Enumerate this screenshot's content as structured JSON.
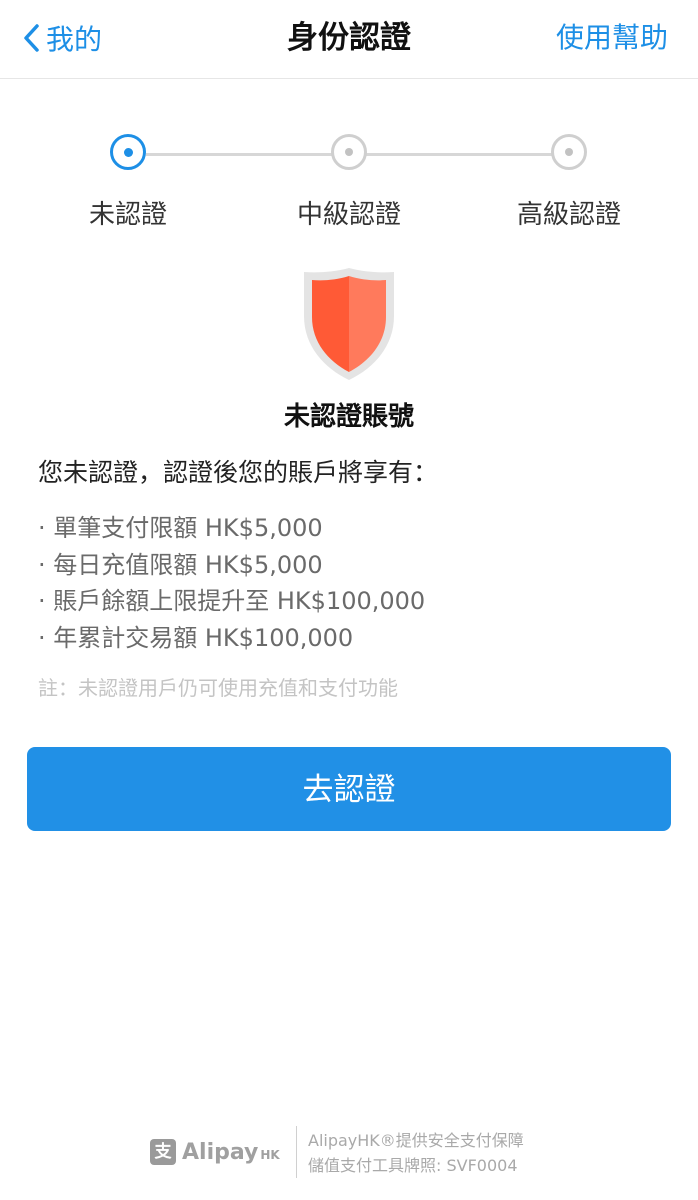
{
  "nav": {
    "back_label": "我的",
    "title": "身份認證",
    "help_label": "使用幫助"
  },
  "stepper": {
    "steps": [
      {
        "label": "未認證",
        "active": true
      },
      {
        "label": "中級認證",
        "active": false
      },
      {
        "label": "高級認證",
        "active": false
      }
    ]
  },
  "account": {
    "status_title": "未認證賬號",
    "intro": "您未認證，認證後您的賬戶將享有：",
    "benefits": [
      "· 單筆支付限額 HK$5,000",
      "· 每日充值限額 HK$5,000",
      "· 賬戶餘額上限提升至 HK$100,000",
      "· 年累計交易額 HK$100,000"
    ],
    "note": "註：未認證用戶仍可使用充值和支付功能"
  },
  "cta": {
    "label": "去認證"
  },
  "footer": {
    "logo_mark": "支",
    "logo_text": "Alipay",
    "logo_sub": "HK",
    "line1": "AlipayHK®提供安全支付保障",
    "line2": "儲值支付工具牌照: SVF0004"
  },
  "colors": {
    "accent": "#1d8fe6",
    "button": "#2190e6",
    "shield_left": "#ff5a36",
    "shield_right": "#ff7a5c"
  },
  "icons": {
    "back": "chevron-left-icon",
    "shield": "shield-icon",
    "logo": "alipay-logo-icon"
  }
}
